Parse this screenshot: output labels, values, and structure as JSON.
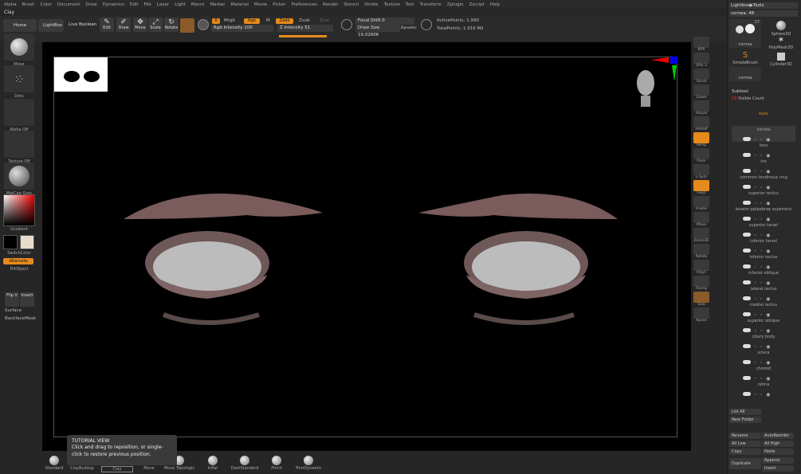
{
  "menu": [
    "Alpha",
    "Brush",
    "Color",
    "Document",
    "Draw",
    "Dynamics",
    "Edit",
    "File",
    "Layer",
    "Light",
    "Macro",
    "Marker",
    "Material",
    "Movie",
    "Picker",
    "Preferences",
    "Render",
    "Stencil",
    "Stroke",
    "Texture",
    "Tool",
    "Transform",
    "Zplugin",
    "Zscript",
    "Help"
  ],
  "app_title": "Clay",
  "top": {
    "home": "Home Page",
    "lightbox": "LightBox",
    "live_boolean": "Live Boolean",
    "edit": "Edit",
    "draw": "Draw",
    "move": "Move",
    "scale": "Scale",
    "rotate": "Rotate",
    "a": "A",
    "mrgb": "Mrgb",
    "rgb": "Rgb",
    "m": "M",
    "zadd": "Zadd",
    "zsub": "Zsub",
    "zcut": "Zcut",
    "rgb_intensity": "Rgb Intensity 100",
    "z_intensity": "Z Intensity 51",
    "focal_shift": "Focal Shift 0",
    "draw_size": "Draw Size 19.02606",
    "dynamic": "Dynamic",
    "active_points": "ActivePoints: 1.990",
    "total_points": "TotalPoints: 1.916 Mil"
  },
  "left": {
    "move": "Move",
    "dots": "Dots",
    "alpha_off": "Alpha Off",
    "texture_off": "Texture Off",
    "matcap": "MatCap Gray",
    "gradient": "Gradient",
    "switch_color": "SwitchColor",
    "alternate": "Alternate",
    "fill_object": "FillObject",
    "flip": "Flip V",
    "invert": "Invert",
    "surface": "Surface",
    "backface": "BackfaceMask"
  },
  "right_tools": [
    "BPR",
    "SPix 3",
    "Scroll",
    "Zoom",
    "Actual",
    "AAHalf",
    "Persp",
    "Floor",
    "L.Sym",
    "Gxyz",
    "Frame",
    "Move",
    "Zoom3D",
    "Rotate",
    "PolyF",
    "Transp",
    "Solo",
    "Xpose"
  ],
  "lightbox_tools": "Lightbox▶Tools",
  "tool_name": "cornea. 48",
  "tool_count": "17",
  "tools": [
    "cornea",
    "Sphere3D",
    "PolyMesh3D",
    "SimpleBrush",
    "Cylinder3D",
    "cornea"
  ],
  "subtool": {
    "title": "Subtool",
    "visible_count": "Visible Count",
    "vcount": "19",
    "items": [
      "eyes",
      "cornea",
      "lens",
      "iris",
      "common tendinous ring",
      "superior rectus",
      "levator palpebrae superioris",
      "superior tarsel",
      "inferior tarsel",
      "inferior rectus",
      "inferior oblique",
      "lateral rectus",
      "medial rectus",
      "superior oblique",
      "ciliary body",
      "sclera",
      "choroid",
      "retina"
    ]
  },
  "bottom_right": {
    "list_all": "List All",
    "new_folder": "New Folder",
    "rename": "Rename",
    "autoreorder": "AutoReorder",
    "all_low": "All Low",
    "all_high": "All High",
    "copy": "Copy",
    "paste": "Paste",
    "duplicate": "Duplicate",
    "append": "Append",
    "insert": "Insert"
  },
  "brushes": [
    "Standard",
    "ClayBuildup",
    "Clay",
    "Move",
    "Move Topologic",
    "Inflat",
    "DamStandard",
    "Pinch",
    "TrimDynamic"
  ],
  "tutorial": {
    "title": "TUTORIAL VIEW",
    "text": "Click and drag to reposition, or single-click to restore previous position."
  }
}
